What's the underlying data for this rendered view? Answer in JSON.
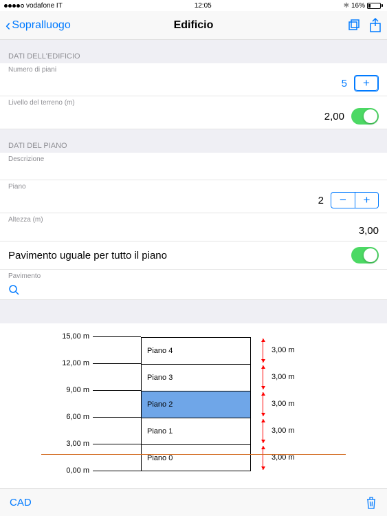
{
  "status": {
    "carrier": "vodafone IT",
    "time": "12:05",
    "battery_pct": "16%"
  },
  "nav": {
    "back": "Sopralluogo",
    "title": "Edificio"
  },
  "sections": {
    "building_header": "DATI DELL'EDIFICIO",
    "floor_header": "DATI DEL PIANO"
  },
  "building": {
    "num_floors_label": "Numero di piani",
    "num_floors_value": "5",
    "ground_level_label": "Livello del terreno (m)",
    "ground_level_value": "2,00"
  },
  "floor": {
    "description_label": "Descrizione",
    "floor_label": "Piano",
    "floor_value": "2",
    "height_label": "Altezza (m)",
    "height_value": "3,00",
    "same_pavement_label": "Pavimento uguale per tutto il piano",
    "pavement_label": "Pavimento"
  },
  "diagram": {
    "ticks": [
      "15,00 m",
      "12,00 m",
      "9,00 m",
      "6,00 m",
      "3,00 m",
      "0,00 m"
    ],
    "floors": [
      {
        "label": "Piano 4",
        "height": "3,00 m",
        "selected": false
      },
      {
        "label": "Piano 3",
        "height": "3,00 m",
        "selected": false
      },
      {
        "label": "Piano 2",
        "height": "3,00 m",
        "selected": true
      },
      {
        "label": "Piano 1",
        "height": "3,00 m",
        "selected": false
      },
      {
        "label": "Piano 0",
        "height": "3,00 m",
        "selected": false
      }
    ]
  },
  "toolbar": {
    "cad_label": "CAD"
  }
}
